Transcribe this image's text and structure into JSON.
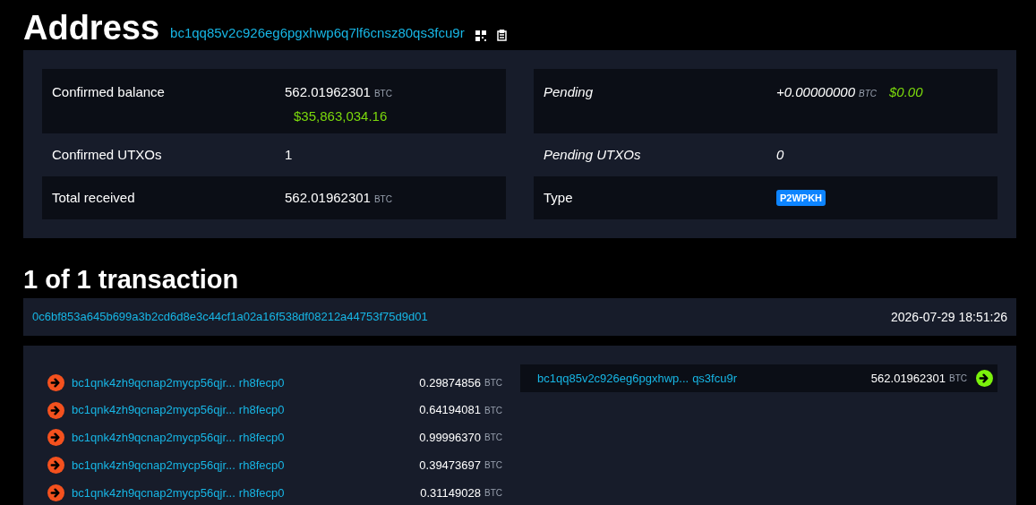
{
  "heading": {
    "title": "Address",
    "address": "bc1qq85v2c926eg6pgxhwp6q7lf6cnsz80qs3fcu9r"
  },
  "summary": {
    "left": [
      {
        "pending": false,
        "label": "Confirmed balance",
        "kind": "amount",
        "value": "562.01962301",
        "unit": "BTC",
        "fiat": "$35,863,034.16"
      },
      {
        "pending": false,
        "label": "Confirmed UTXOs",
        "kind": "count",
        "value": "1"
      },
      {
        "pending": false,
        "label": "Total received",
        "kind": "amount",
        "value": "562.01962301",
        "unit": "BTC"
      }
    ],
    "right": [
      {
        "pending": true,
        "label": "Pending",
        "kind": "amount",
        "value": "+0.00000000",
        "unit": "BTC",
        "fiat": "$0.00"
      },
      {
        "pending": true,
        "label": "Pending UTXOs",
        "kind": "count",
        "value": "0"
      },
      {
        "pending": false,
        "label": "Type",
        "kind": "badge",
        "value": "P2WPKH"
      }
    ]
  },
  "transactions_heading": "1 of 1 transaction",
  "transaction": {
    "txid": "0c6bf853a645b699a3b2cd6d8e3c44cf1a02a16f538df08212a44753f75d9d01",
    "time": "2026-07-29 18:51:26",
    "inputs": [
      {
        "address_start": "bc1qnk4zh9qcnap2mycp56qjr...",
        "address_end": "rh8fecp0",
        "amount": "0.29874856",
        "unit": "BTC"
      },
      {
        "address_start": "bc1qnk4zh9qcnap2mycp56qjr...",
        "address_end": "rh8fecp0",
        "amount": "0.64194081",
        "unit": "BTC"
      },
      {
        "address_start": "bc1qnk4zh9qcnap2mycp56qjr...",
        "address_end": "rh8fecp0",
        "amount": "0.99996370",
        "unit": "BTC"
      },
      {
        "address_start": "bc1qnk4zh9qcnap2mycp56qjr...",
        "address_end": "rh8fecp0",
        "amount": "0.39473697",
        "unit": "BTC"
      },
      {
        "address_start": "bc1qnk4zh9qcnap2mycp56qjr...",
        "address_end": "rh8fecp0",
        "amount": "0.31149028",
        "unit": "BTC"
      }
    ],
    "outputs": [
      {
        "address_start": "bc1qq85v2c926eg6pgxhwp...",
        "address_end": "qs3fcu9r",
        "amount": "562.01962301",
        "unit": "BTC"
      }
    ]
  }
}
